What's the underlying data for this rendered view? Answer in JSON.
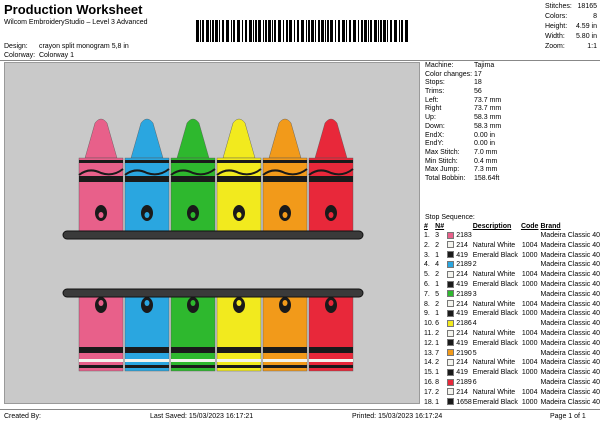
{
  "header": {
    "title": "Production Worksheet",
    "subtitle": "Wilcom EmbroideryStudio – Level 3 Advanced"
  },
  "stats": [
    {
      "label": "Stitches:",
      "value": "18165"
    },
    {
      "label": "Colors:",
      "value": "8"
    },
    {
      "label": "Height:",
      "value": "4.59 in"
    },
    {
      "label": "Width:",
      "value": "5.80 in"
    },
    {
      "label": "Zoom:",
      "value": "1:1"
    }
  ],
  "design": {
    "label": "Design:",
    "value": "crayon split monogram 5,8 in"
  },
  "colorway": {
    "label": "Colorway:",
    "value": "Colorway 1"
  },
  "machine_info": [
    {
      "label": "Machine:",
      "value": "Tajima"
    },
    {
      "label": "Color changes:",
      "value": "17"
    },
    {
      "label": "Stops:",
      "value": "18"
    },
    {
      "label": "Trims:",
      "value": "56"
    },
    {
      "label": "Left:",
      "value": "73.7 mm"
    },
    {
      "label": "Right",
      "value": "73.7 mm"
    },
    {
      "label": "Up:",
      "value": "58.3 mm"
    },
    {
      "label": "Down:",
      "value": "58.3 mm"
    },
    {
      "label": "EndX:",
      "value": "0.00 in"
    },
    {
      "label": "EndY:",
      "value": "0.00 in"
    },
    {
      "label": "Max Stitch:",
      "value": "7.0 mm"
    },
    {
      "label": "Min Stitch:",
      "value": "0.4 mm"
    },
    {
      "label": "Max Jump:",
      "value": "7.3 mm"
    },
    {
      "label": "Total Bobbin:",
      "value": "158.64ft"
    }
  ],
  "stop_sequence": {
    "label": "Stop Sequence:",
    "headers": [
      "#",
      "N#",
      "Description",
      "Code",
      "Brand"
    ],
    "rows": [
      {
        "stop": "1.",
        "n": "3",
        "color": "#e8608a",
        "code_n": "2183",
        "desc": "",
        "code": "",
        "brand": "Madeira Classic 40"
      },
      {
        "stop": "2.",
        "n": "2",
        "color": "#f4f4ee",
        "code_n": "214",
        "desc": "Natural White",
        "code": "1004",
        "brand": "Madeira Classic 40"
      },
      {
        "stop": "3.",
        "n": "1",
        "color": "#1a1a1a",
        "code_n": "419",
        "desc": "Emerald Black",
        "code": "1000",
        "brand": "Madeira Classic 40"
      },
      {
        "stop": "4.",
        "n": "4",
        "color": "#2aa6e0",
        "code_n": "2189",
        "desc": "2",
        "code": "",
        "brand": "Madeira Classic 40"
      },
      {
        "stop": "5.",
        "n": "2",
        "color": "#f4f4ee",
        "code_n": "214",
        "desc": "Natural White",
        "code": "1004",
        "brand": "Madeira Classic 40"
      },
      {
        "stop": "6.",
        "n": "1",
        "color": "#1a1a1a",
        "code_n": "419",
        "desc": "Emerald Black",
        "code": "1000",
        "brand": "Madeira Classic 40"
      },
      {
        "stop": "7.",
        "n": "5",
        "color": "#2eb82e",
        "code_n": "2189",
        "desc": "3",
        "code": "",
        "brand": "Madeira Classic 40"
      },
      {
        "stop": "8.",
        "n": "2",
        "color": "#f4f4ee",
        "code_n": "214",
        "desc": "Natural White",
        "code": "1004",
        "brand": "Madeira Classic 40"
      },
      {
        "stop": "9.",
        "n": "1",
        "color": "#1a1a1a",
        "code_n": "419",
        "desc": "Emerald Black",
        "code": "1000",
        "brand": "Madeira Classic 40"
      },
      {
        "stop": "10.",
        "n": "6",
        "color": "#f2ea1e",
        "code_n": "2186",
        "desc": "4",
        "code": "",
        "brand": "Madeira Classic 40"
      },
      {
        "stop": "11.",
        "n": "2",
        "color": "#f4f4ee",
        "code_n": "214",
        "desc": "Natural White",
        "code": "1004",
        "brand": "Madeira Classic 40"
      },
      {
        "stop": "12.",
        "n": "1",
        "color": "#1a1a1a",
        "code_n": "419",
        "desc": "Emerald Black",
        "code": "1000",
        "brand": "Madeira Classic 40"
      },
      {
        "stop": "13.",
        "n": "7",
        "color": "#f29a1a",
        "code_n": "2190",
        "desc": "5",
        "code": "",
        "brand": "Madeira Classic 40"
      },
      {
        "stop": "14.",
        "n": "2",
        "color": "#f4f4ee",
        "code_n": "214",
        "desc": "Natural White",
        "code": "1004",
        "brand": "Madeira Classic 40"
      },
      {
        "stop": "15.",
        "n": "1",
        "color": "#1a1a1a",
        "code_n": "419",
        "desc": "Emerald Black",
        "code": "1000",
        "brand": "Madeira Classic 40"
      },
      {
        "stop": "16.",
        "n": "8",
        "color": "#e8283a",
        "code_n": "2189",
        "desc": "6",
        "code": "",
        "brand": "Madeira Classic 40"
      },
      {
        "stop": "17.",
        "n": "2",
        "color": "#f4f4ee",
        "code_n": "214",
        "desc": "Natural White",
        "code": "1004",
        "brand": "Madeira Classic 40"
      },
      {
        "stop": "18.",
        "n": "1",
        "color": "#1a1a1a",
        "code_n": "1658",
        "desc": "Emerald Black",
        "code": "1000",
        "brand": "Madeira Classic 40"
      }
    ]
  },
  "design_preview": {
    "crayon_colors": [
      "#e8608a",
      "#2aa6e0",
      "#2eb82e",
      "#f2ea1e",
      "#f29a1a",
      "#e8283a"
    ],
    "stripe_color": "#1a1a1a",
    "background": "#c9c9c9"
  },
  "footer": {
    "created_by": "Created By:",
    "last_saved": "Last Saved: 15/03/2023 16:17:21",
    "printed": "Printed: 15/03/2023 16:17:24",
    "page": "Page 1 of 1"
  }
}
